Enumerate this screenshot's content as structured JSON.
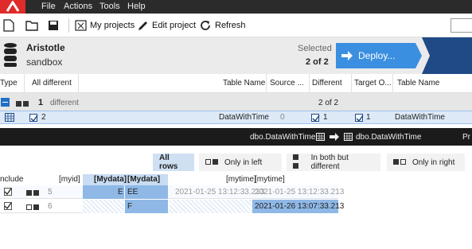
{
  "menu": {
    "items": [
      "File",
      "Actions",
      "Tools",
      "Help"
    ]
  },
  "toolbar": {
    "my_projects": "My projects",
    "edit_project": "Edit project",
    "refresh": "Refresh"
  },
  "project": {
    "name": "Aristotle",
    "environment": "sandbox",
    "selected_label": "Selected",
    "selected_count": "2 of 2",
    "deploy_label": "Deploy..."
  },
  "columns": {
    "type": "Type",
    "all_different": "All different",
    "table_name_left": "Table Name",
    "source": "Source ...",
    "different": "Different",
    "target": "Target O...",
    "table_name_right": "Table Name"
  },
  "group_row": {
    "count": "1",
    "label": "different",
    "summary": "2 of 2"
  },
  "data_row": {
    "all_different": "2",
    "table_left": "DataWithTime",
    "source": "0",
    "different": "1",
    "target": "1",
    "table_right": "DataWithTime"
  },
  "compare_bar": {
    "left_table": "dbo.DataWithTime",
    "right_table": "dbo.DataWithTime",
    "cut_text": "Pr"
  },
  "tabs": {
    "all_rows": "All rows",
    "only_left": "Only in left",
    "both_different": "In both but different",
    "only_right": "Only in right"
  },
  "grid": {
    "headers": {
      "include": "nclude",
      "myid": "[myid]",
      "mydata_left": "[Mydata]",
      "mydata_right": "[Mydata]",
      "mytime_left": "[mytime]",
      "mytime_right": "[mytime]"
    },
    "rows": [
      {
        "myid": "5",
        "mydata_left": "E",
        "mydata_right": "EE",
        "mytime_left": "2021-01-25 13:12:33.213",
        "mytime_right": "2021-01-25 13:12:33.213"
      },
      {
        "myid": "6",
        "mydata_left": "",
        "mydata_right": "F",
        "mytime_left": "",
        "mytime_right": "2021-01-26 13:07:33.213"
      }
    ]
  },
  "colors": {
    "accent": "#3a8fe0",
    "navy": "#1f4a86",
    "logo_red": "#e02b2b",
    "highlight": "#8fb8e6"
  }
}
